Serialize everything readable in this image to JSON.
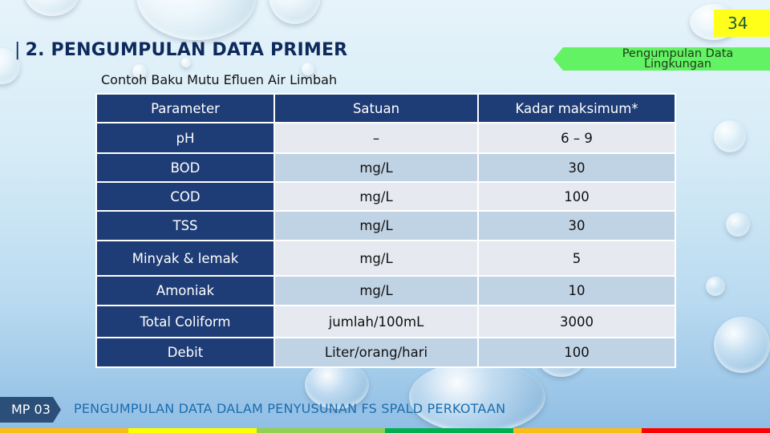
{
  "page_number": "34",
  "title": {
    "prefix": "|",
    "text": "2. PENGUMPULAN DATA PRIMER"
  },
  "section_tag": {
    "line1": "Pengumpulan Data",
    "line2": "Lingkungan",
    "color": "#63f263"
  },
  "subtitle": "Contoh Baku Mutu Efluen Air Limbah",
  "table": {
    "headers": [
      "Parameter",
      "Satuan",
      "Kadar maksimum*"
    ],
    "rows": [
      {
        "parameter": "pH",
        "satuan": "–",
        "kadar": "6 – 9"
      },
      {
        "parameter": "BOD",
        "satuan": "mg/L",
        "kadar": "30"
      },
      {
        "parameter": "COD",
        "satuan": "mg/L",
        "kadar": "100"
      },
      {
        "parameter": "TSS",
        "satuan": "mg/L",
        "kadar": "30"
      },
      {
        "parameter": "Minyak & lemak",
        "satuan": "mg/L",
        "kadar": "5"
      },
      {
        "parameter": "Amoniak",
        "satuan": "mg/L",
        "kadar": "10"
      },
      {
        "parameter": "Total Coliform",
        "satuan": "jumlah/100mL",
        "kadar": "3000"
      },
      {
        "parameter": "Debit",
        "satuan": "Liter/orang/hari",
        "kadar": "100"
      }
    ],
    "header_color": "#1e3c76",
    "row_colors": [
      "#e6e9f0",
      "#c0d3e4"
    ]
  },
  "footer": {
    "badge": "MP 03",
    "text": "PENGUMPULAN DATA DALAM PENYUSUNAN FS SPALD PERKOTAAN"
  },
  "color_strip": [
    "#fbbd16",
    "#ffff00",
    "#92d050",
    "#00b050",
    "#fbbd16",
    "#ff0000"
  ]
}
